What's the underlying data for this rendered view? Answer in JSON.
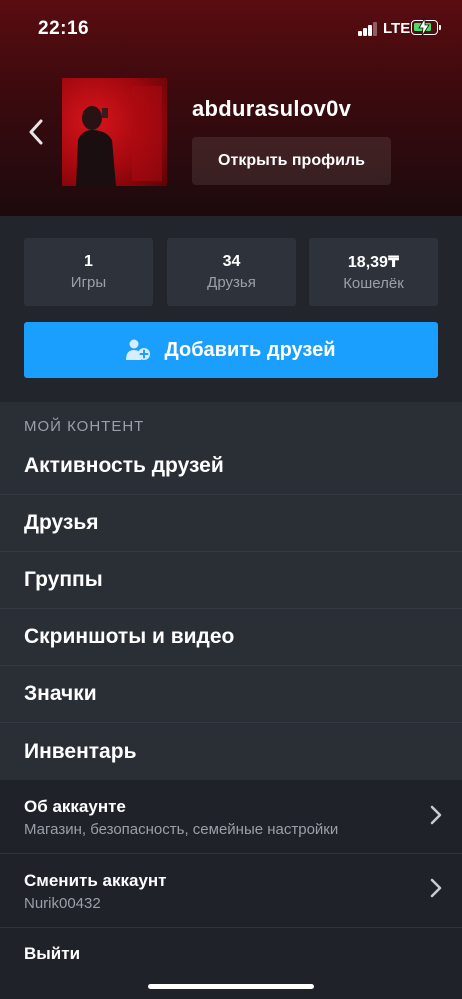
{
  "status_bar": {
    "time": "22:16",
    "network": "LTE"
  },
  "profile": {
    "username": "abdurasulov0v",
    "open_profile_label": "Открыть профиль"
  },
  "stats": [
    {
      "value": "1",
      "label": "Игры"
    },
    {
      "value": "34",
      "label": "Друзья"
    },
    {
      "value": "18,39₸",
      "label": "Кошелёк"
    }
  ],
  "add_friends_label": "Добавить друзей",
  "content": {
    "section_title": "МОЙ КОНТЕНТ",
    "items": [
      {
        "label": "Активность друзей"
      },
      {
        "label": "Друзья"
      },
      {
        "label": "Группы"
      },
      {
        "label": "Скриншоты и видео"
      },
      {
        "label": "Значки"
      },
      {
        "label": "Инвентарь"
      }
    ]
  },
  "footer": {
    "account": {
      "title": "Об аккаунте",
      "subtitle": "Магазин, безопасность, семейные настройки"
    },
    "switch": {
      "title": "Сменить аккаунт",
      "subtitle": "Nurik00432"
    },
    "logout": {
      "title": "Выйти"
    }
  },
  "colors": {
    "accent": "#1a9fff",
    "header_top": "#5a0c10",
    "panel": "#22252b",
    "battery_charging": "#4cd964"
  },
  "icons": {
    "back": "chevron-left-icon",
    "add_friend": "add-user-icon",
    "forward": "chevron-right-icon",
    "battery": "battery-charging-icon",
    "signal": "signal-icon"
  }
}
